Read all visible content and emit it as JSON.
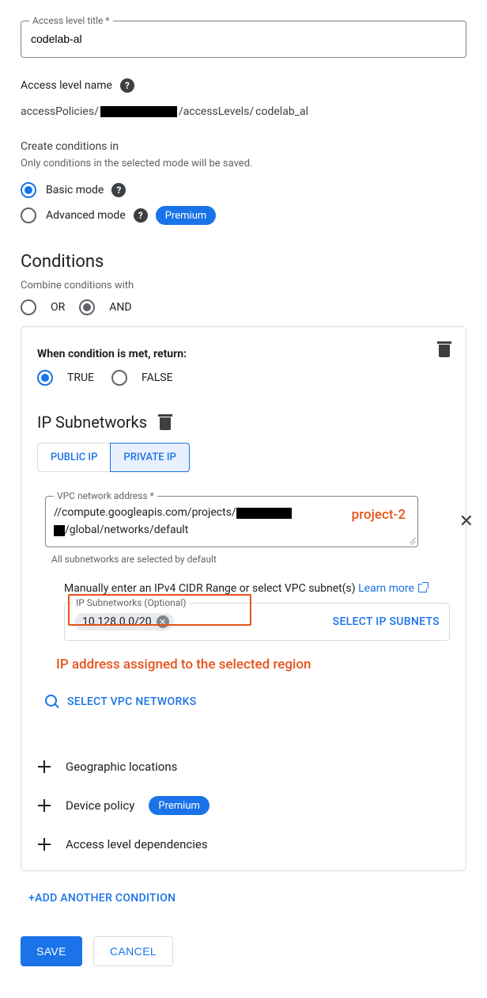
{
  "title_field": {
    "label": "Access level title *",
    "value": "codelab-al"
  },
  "name_row": {
    "label": "Access level name",
    "prefix": "accessPolicies/",
    "mid": "/accessLevels/",
    "suffix": "codelab_al"
  },
  "create_conditions": {
    "label": "Create conditions in",
    "helper": "Only conditions in the selected mode will be saved."
  },
  "mode": {
    "basic": "Basic mode",
    "advanced": "Advanced mode",
    "selected": "basic",
    "premium": "Premium"
  },
  "conditions_heading": "Conditions",
  "combine": {
    "label": "Combine conditions with",
    "or": "OR",
    "and": "AND",
    "selected": "and"
  },
  "card": {
    "when_label": "When condition is met, return:",
    "true": "TRUE",
    "false": "FALSE",
    "selected": "true",
    "subheading": "IP Subnetworks",
    "tabs": {
      "public": "PUBLIC IP",
      "private": "PRIVATE IP",
      "active": "private"
    },
    "vpc": {
      "legend": "VPC network address *",
      "line1_pre": "//compute.googleapis.com/projects/",
      "line2_suf": "/global/networks/default",
      "annotation": "project-2"
    },
    "subnet_caption": "All subnetworks are selected by default",
    "manual_line": "Manually enter an IPv4 CIDR Range or select VPC subnet(s)",
    "learn_more": "Learn more",
    "ip_box": {
      "legend": "IP Subnetworks (Optional)",
      "chip": "10.128.0.0/20",
      "button": "SELECT IP SUBNETS"
    },
    "ip_annotation": "IP address assigned to the selected region",
    "select_networks": "SELECT VPC NETWORKS",
    "rows": {
      "geo": "Geographic locations",
      "device": "Device policy",
      "deps": "Access level dependencies",
      "premium": "Premium"
    }
  },
  "add_another": "+ADD ANOTHER CONDITION",
  "buttons": {
    "save": "SAVE",
    "cancel": "CANCEL"
  }
}
